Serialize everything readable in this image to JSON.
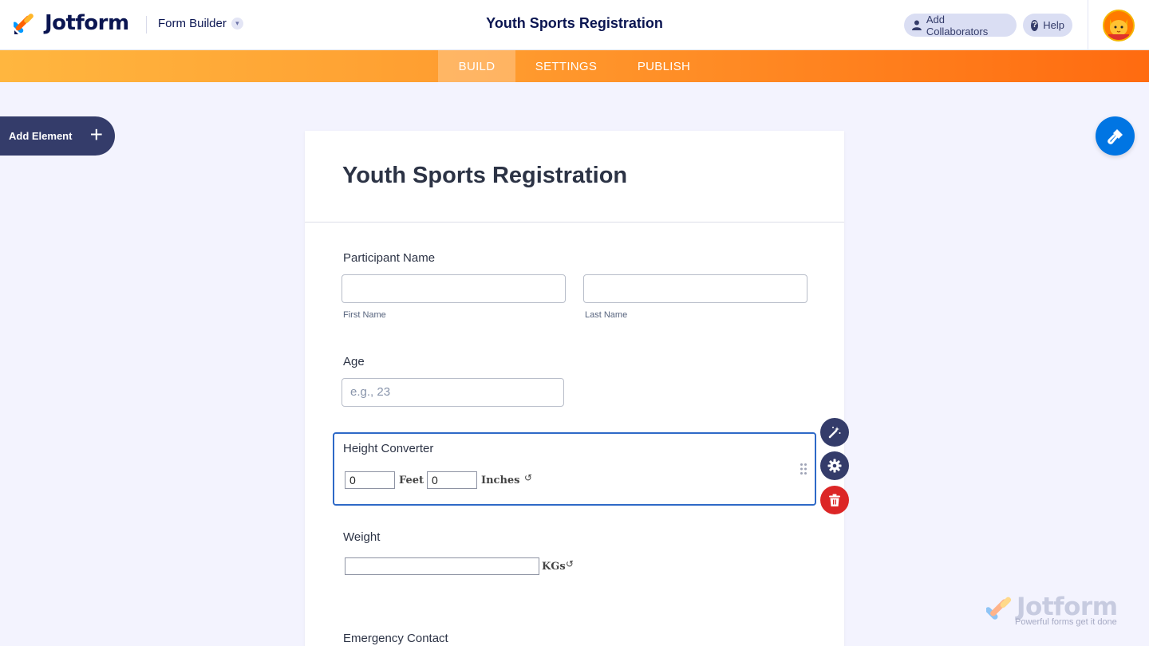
{
  "header": {
    "brand": "Jotform",
    "builder_menu": "Form Builder",
    "title": "Youth Sports Registration",
    "add_collaborators": "Add Collaborators",
    "help": "Help"
  },
  "nav": {
    "tabs": [
      {
        "label": "BUILD",
        "active": true
      },
      {
        "label": "SETTINGS",
        "active": false
      },
      {
        "label": "PUBLISH",
        "active": false
      }
    ]
  },
  "sidebar": {
    "add_element": "Add Element"
  },
  "form": {
    "title": "Youth Sports Registration",
    "participant": {
      "label": "Participant Name",
      "first_sub": "First Name",
      "last_sub": "Last Name",
      "first_value": "",
      "last_value": ""
    },
    "age": {
      "label": "Age",
      "placeholder": "e.g., 23"
    },
    "height": {
      "label": "Height Converter",
      "feet_value": "0",
      "feet_unit": "Feet",
      "inches_value": "0",
      "inches_unit": "Inches",
      "reset": "↺"
    },
    "weight": {
      "label": "Weight",
      "value": "",
      "unit": "KGs",
      "reset": "↺"
    },
    "emergency": {
      "label": "Emergency Contact"
    }
  },
  "watermark": {
    "brand": "Jotform",
    "tagline": "Powerful forms get it done"
  },
  "colors": {
    "accent_blue": "#0075e3",
    "navy": "#343c6a",
    "delete_red": "#dc2626",
    "orange_start": "#ffb63f",
    "orange_end": "#ff6b10"
  }
}
